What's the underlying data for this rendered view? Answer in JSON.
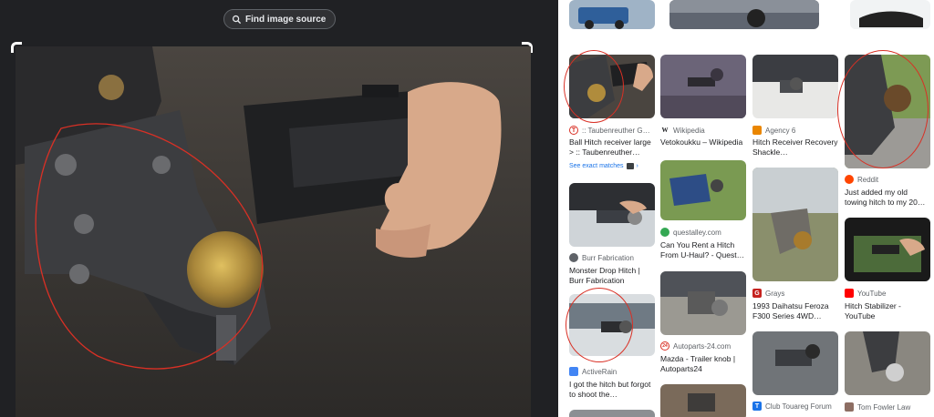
{
  "viewer": {
    "find_source_label": "Find image source"
  },
  "results": [
    {
      "source": ":: Taubenreuther G…",
      "title": "Ball Hitch receiver large > :: Taubenreuther…",
      "favicon_letter": "T",
      "favicon_color": "#d93025",
      "exact_matches_label": "See exact matches"
    },
    {
      "source": "Burr Fabrication",
      "title": "Monster Drop Hitch | Burr Fabrication",
      "favicon_letter": "",
      "favicon_color": "#5f6368"
    },
    {
      "source": "ActiveRain",
      "title": "I got the hitch but forgot to shoot the…",
      "favicon_letter": "",
      "favicon_color": "#4285f4"
    },
    {
      "source": "Wikipedia",
      "title": "Vetokoukku – Wikipedia",
      "favicon_letter": "W",
      "favicon_color": "#202124"
    },
    {
      "source": "questalley.com",
      "title": "Can You Rent a Hitch From U-Haul? - Quest…",
      "favicon_letter": "",
      "favicon_color": "#34a853"
    },
    {
      "source": "Autoparts-24.com",
      "title": "Mazda - Trailer knob | Autoparts24",
      "favicon_letter": "24",
      "favicon_color": "#d93025"
    },
    {
      "source": "Agency 6",
      "title": "Hitch Receiver Recovery Shackle…",
      "favicon_letter": "",
      "favicon_color": "#ea8600"
    },
    {
      "source": "Grays",
      "title": "1993 Daihatsu Feroza F300 Series 4WD…",
      "favicon_letter": "G",
      "favicon_color": "#c5221f"
    },
    {
      "source": "Club Touareg Forum",
      "title": "",
      "favicon_letter": "T",
      "favicon_color": "#1a73e8"
    },
    {
      "source": "Reddit",
      "title": "Just added my old towing hitch to my 20…",
      "favicon_letter": "",
      "favicon_color": "#ff4500"
    },
    {
      "source": "YouTube",
      "title": "Hitch Stabilizer - YouTube",
      "favicon_letter": "",
      "favicon_color": "#ff0000"
    },
    {
      "source": "Tom Fowler Law",
      "title": "",
      "favicon_letter": "",
      "favicon_color": "#8d6e63"
    }
  ],
  "icons": {
    "find_source": "lens-search-icon",
    "exact_matches": "image-stack-icon",
    "exact_arrow": "chevron-right-icon"
  },
  "colors": {
    "panel_bg": "#202124",
    "annotation_red": "#d93025",
    "link_blue": "#1a73e8"
  }
}
